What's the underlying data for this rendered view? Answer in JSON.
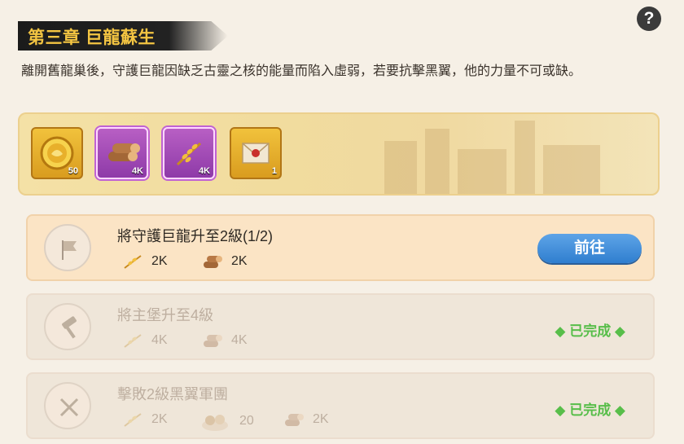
{
  "chapter": {
    "title": "第三章 巨龍蘇生",
    "description": "離開舊龍巢後，守護巨龍因缺乏古靈之核的能量而陷入虛弱，若要抗擊黑翼，他的力量不可或缺。"
  },
  "help_icon": "question-icon",
  "rewards": [
    {
      "icon": "gold-coin-icon",
      "count": "50"
    },
    {
      "icon": "wood-log-icon",
      "count": "4K"
    },
    {
      "icon": "wheat-icon",
      "count": "4K"
    },
    {
      "icon": "sealed-letter-icon",
      "count": "1"
    }
  ],
  "tasks": [
    {
      "title": "將守護巨龍升至2級(1/2)",
      "icon": "banner-flag-icon",
      "reqs": [
        {
          "icon": "wheat-icon",
          "text": "2K"
        },
        {
          "icon": "wood-log-icon",
          "text": "2K"
        }
      ],
      "action": "前往",
      "status": "active"
    },
    {
      "title": "將主堡升至4級",
      "icon": "hammer-icon",
      "reqs": [
        {
          "icon": "wheat-icon",
          "text": "4K"
        },
        {
          "icon": "wood-log-icon",
          "text": "4K"
        }
      ],
      "status_text": "已完成",
      "status": "done"
    },
    {
      "title": "擊敗2級黑翼軍團",
      "icon": "crossed-swords-icon",
      "reqs": [
        {
          "icon": "wheat-icon",
          "text": "2K"
        },
        {
          "icon": "food-pile-icon",
          "text": "20"
        },
        {
          "icon": "wood-log-icon",
          "text": "2K"
        }
      ],
      "status_text": "已完成",
      "status": "done"
    }
  ],
  "colors": {
    "accent_gold": "#f4c542",
    "action_blue": "#2f7ecf",
    "done_green": "#47b93a"
  }
}
